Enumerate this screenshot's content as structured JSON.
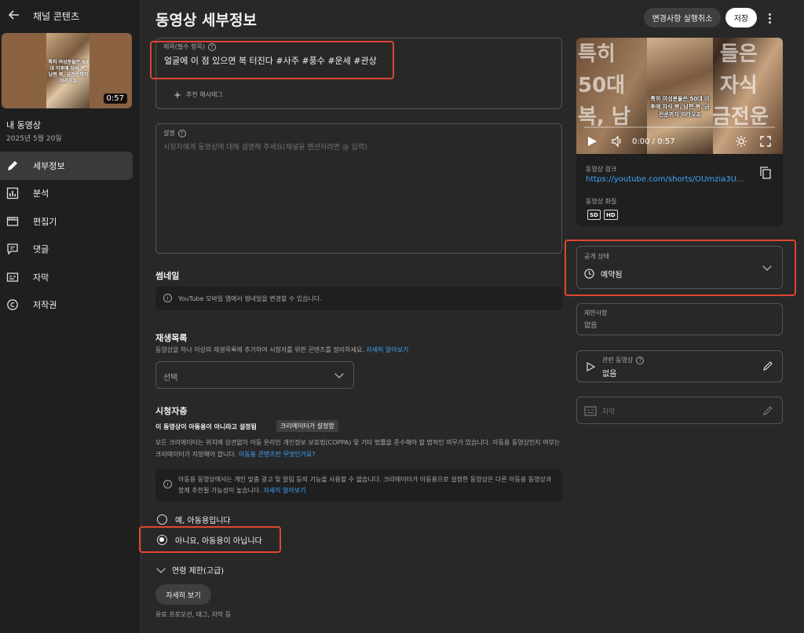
{
  "sidebar": {
    "header_title": "채널 콘텐츠",
    "thumbnail": {
      "overlay_text": "특히 여성분들은 50대 이후에 자식 복, 남편 복, 금전운까지 따라오죠",
      "duration": "0:57"
    },
    "my_video_label": "내 동영상",
    "date": "2025년 5월 20일",
    "items": [
      {
        "label": "세부정보",
        "icon": "pencil-icon"
      },
      {
        "label": "분석",
        "icon": "analytics-icon"
      },
      {
        "label": "편집기",
        "icon": "editor-icon"
      },
      {
        "label": "댓글",
        "icon": "comments-icon"
      },
      {
        "label": "자막",
        "icon": "subtitles-icon"
      },
      {
        "label": "저작권",
        "icon": "copyright-icon"
      }
    ]
  },
  "header": {
    "title": "동영상 세부정보",
    "undo_label": "변경사항 실행취소",
    "save_label": "저장"
  },
  "title_field": {
    "label": "제목(필수 항목)",
    "value": "얼굴에 이 점 있으면 복 터진다 #사주 #풍수 #운세 #관상",
    "hashtag_button": "추천 해시태그"
  },
  "description_field": {
    "label": "설명",
    "placeholder": "시청자에게 동영상에 대해 설명해 주세요(채널을 멘션하려면 @ 입력)"
  },
  "thumbnail_section": {
    "title": "썸네일",
    "info": "YouTube 모바일 앱에서 썸네일을 변경할 수 있습니다."
  },
  "playlist_section": {
    "title": "재생목록",
    "desc": "동영상을 하나 이상의 재생목록에 추가하여 시청자를 위한 콘텐츠를 정리하세요.",
    "link": "자세히 알아보기",
    "select_value": "선택"
  },
  "audience_section": {
    "title": "시청자층",
    "setting": "이 동영상이 아동용이 아니라고 설정됨",
    "badge": "크리에이터가 설정함",
    "desc": "모든 크리에이터는 위치에 상관없이 아동 온라인 개인정보 보호법(COPPA) 및 기타 법률을 준수해야 할 법적인 의무가 있습니다. 아동용 동영상인지 여부는 크리에이터가 지정해야 합니다.",
    "desc_link": "아동용 콘텐츠란 무엇인가요?",
    "info": "아동용 동영상에서는 개인 맞춤 광고 및 알림 등의 기능을 사용할 수 없습니다. 크리에이터가 아동용으로 설정한 동영상은 다른 아동용 동영상과 함께 추천될 가능성이 높습니다.",
    "info_link": "자세히 알아보기",
    "option_yes": "예, 아동용입니다",
    "option_no": "아니요, 아동용이 아닙니다",
    "selected": "no"
  },
  "age_restriction": {
    "label": "연령 제한(고급)",
    "more_button": "자세히 보기",
    "more_desc": "유료 프로모션, 태그, 자막 등"
  },
  "preview": {
    "bg_text": [
      "특히",
      "들은",
      "50대",
      "자식",
      "복, 남",
      "금전운"
    ],
    "overlay_text": "특히 여성분들은 50대 이후에 자식 복, 남편 복, 금전운까지 따라오죠",
    "time": "0:00 / 0:57",
    "link_label": "동영상 링크",
    "link": "https://youtube.com/shorts/OUmzia3U...",
    "quality_label": "동영상 화질",
    "qualities": [
      "SD",
      "HD"
    ]
  },
  "visibility": {
    "label": "공개 상태",
    "value": "예약됨"
  },
  "restrictions": {
    "label": "제한사항",
    "value": "없음"
  },
  "related_video": {
    "label": "관련 동영상",
    "value": "없음"
  },
  "subtitles": {
    "label": "자막"
  },
  "colors": {
    "accent_link": "#3ea6ff",
    "highlight": "#e0462f",
    "background": "#282828"
  }
}
